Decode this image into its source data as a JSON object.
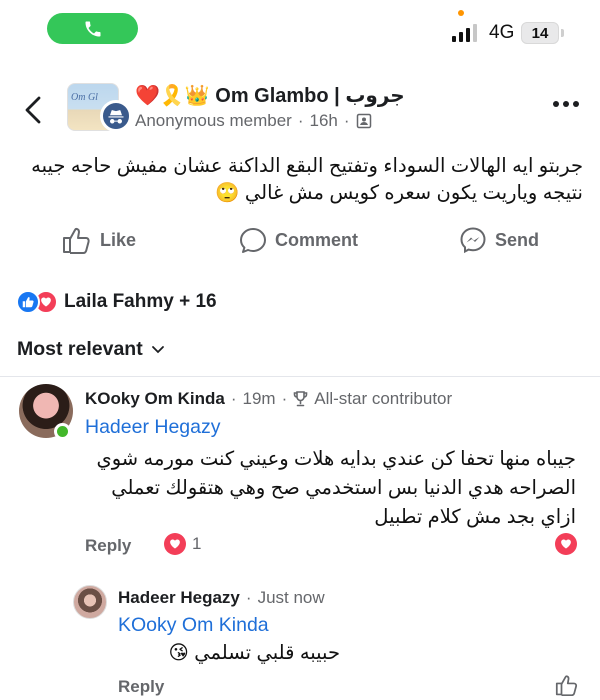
{
  "status_bar": {
    "network": "4G",
    "battery": "14",
    "icons": {
      "call": "phone-icon",
      "signal": "signal-bars-icon"
    }
  },
  "post": {
    "group_name": "❤️🎗️👑 Om Glambo | جروب",
    "author": "Anonymous member",
    "time": "16h",
    "group_avatar_text": "Om Gl",
    "text": "جربتو ايه الهالات السوداء وتفتيح البقع الداكنة عشان مفيش حاجه جيبه نتيجه وياريت يكون سعره كويس مش غالي 🙄",
    "actions": {
      "like": "Like",
      "comment": "Comment",
      "send": "Send"
    },
    "reactions_text": "Laila Fahmy + 16",
    "sort_label": "Most relevant"
  },
  "comments": [
    {
      "author": "KOoky Om Kinda",
      "time": "19m",
      "badge": "All-star contributor",
      "mention": "Hadeer Hegazy",
      "text": "جيباه منها تحفا كن عندي بدايه هلات وعيني كنت مورمه شوي الصراحه هدي الدنيا بس استخدمي صح وهي هتقولك تعملي ازاي بجد مش كلام تطبيل",
      "reply_label": "Reply",
      "reaction_count": "1"
    },
    {
      "author": "Hadeer Hegazy",
      "time": "Just now",
      "mention": "KOoky Om Kinda",
      "text": "حبيبه قلبي تسلمي 😘",
      "reply_label": "Reply"
    }
  ],
  "colors": {
    "accent_blue": "#1f6fd8",
    "like_blue": "#1877f2",
    "love_red": "#f33e58",
    "call_green": "#34c759",
    "online_green": "#42b72a"
  }
}
